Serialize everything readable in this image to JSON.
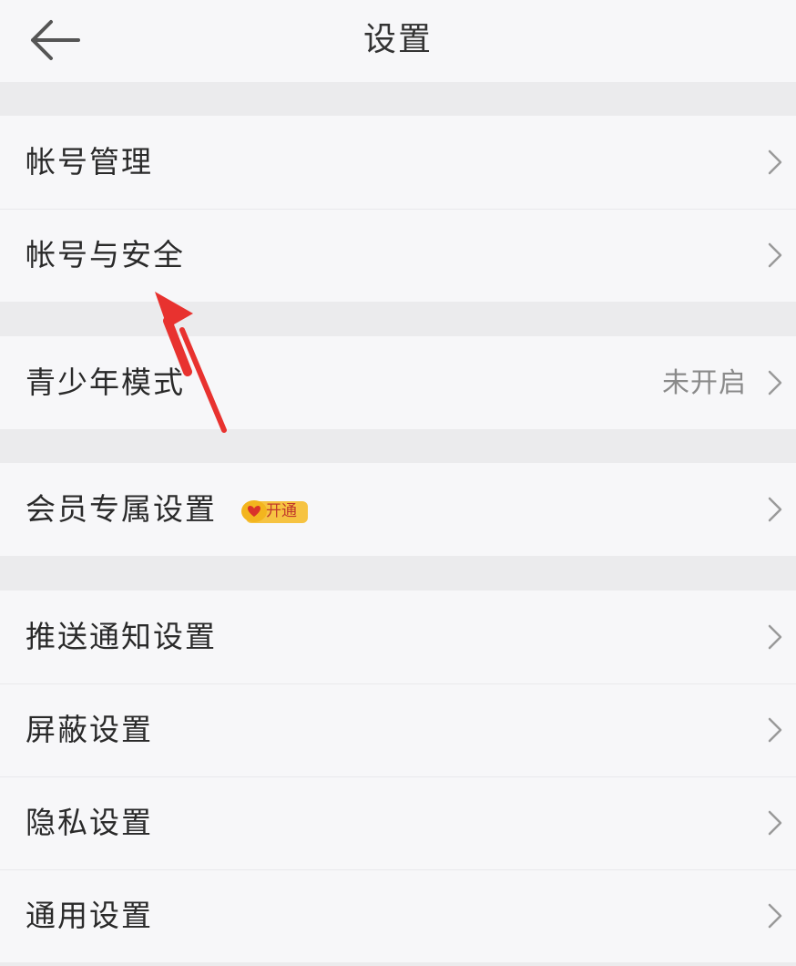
{
  "header": {
    "title": "设置",
    "back_icon": "arrow-left-icon"
  },
  "groups": [
    {
      "items": [
        {
          "label": "帐号管理"
        },
        {
          "label": "帐号与安全"
        }
      ]
    },
    {
      "items": [
        {
          "label": "青少年模式",
          "value": "未开启"
        }
      ]
    },
    {
      "items": [
        {
          "label": "会员专属设置",
          "badge": "开通"
        }
      ]
    },
    {
      "items": [
        {
          "label": "推送通知设置"
        },
        {
          "label": "屏蔽设置"
        },
        {
          "label": "隐私设置"
        },
        {
          "label": "通用设置"
        }
      ]
    }
  ],
  "colors": {
    "background": "#ebebed",
    "row_background": "#f7f7f9",
    "text": "#2a2a2a",
    "secondary_text": "#8a8a8a",
    "badge_gold": "#f6c342",
    "annotation_red": "#e8322f"
  }
}
